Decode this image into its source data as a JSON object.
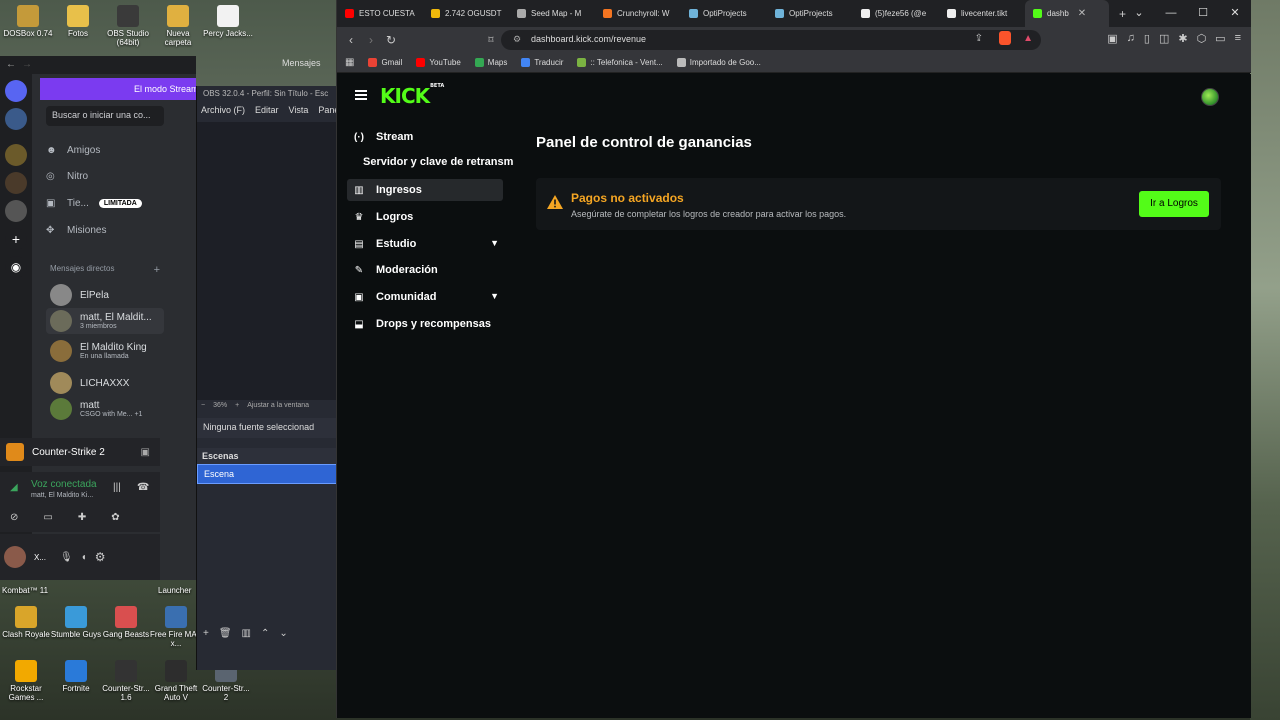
{
  "desktop": {
    "top_icons": [
      {
        "label": "DOSBox 0.74",
        "color": "#c49a3a"
      },
      {
        "label": "Fotos",
        "color": "#e8c04a"
      },
      {
        "label": "OBS Studio (64bit)",
        "color": "#3a3a3a"
      },
      {
        "label": "Nueva carpeta",
        "color": "#e0b040"
      },
      {
        "label": "Percy Jacks...",
        "color": "#f2f2f2"
      }
    ],
    "bottom_icons": [
      {
        "label": "Clash Royale",
        "color": "#d9a52a"
      },
      {
        "label": "Stumble Guys",
        "color": "#3a9ad9"
      },
      {
        "label": "Gang Beasts",
        "color": "#d94f4f"
      },
      {
        "label": "Free Fire MAX x...",
        "color": "#3a6fb0"
      },
      {
        "label": "Rockstar Games ...",
        "color": "#f2a900"
      },
      {
        "label": "Fortnite",
        "color": "#2a7ad9"
      },
      {
        "label": "Counter-Str... 1.6",
        "color": "#333333"
      },
      {
        "label": "Grand Theft Auto V",
        "color": "#2d2d2d"
      },
      {
        "label": "Counter-Str... 2",
        "color": "#5a6470"
      }
    ],
    "partial_labels": {
      "kombat": "Kombat™ 11",
      "launcher": "Launcher"
    }
  },
  "discord": {
    "window_title": "Mensajes",
    "banner": "El modo Stream",
    "search": "Buscar o iniciar una co...",
    "nav": [
      {
        "label": "Amigos",
        "icon": "friends-icon",
        "glyph": "☻"
      },
      {
        "label": "Nitro",
        "icon": "nitro-icon",
        "glyph": "◎"
      },
      {
        "label": "Tie...",
        "icon": "shop-icon",
        "glyph": "▣",
        "badge": "LIMITADA"
      },
      {
        "label": "Misiones",
        "icon": "quests-icon",
        "glyph": "✥"
      }
    ],
    "dm_header": "Mensajes directos",
    "dms": [
      {
        "name": "ElPela",
        "sub": "",
        "color": "#888"
      },
      {
        "name": "matt, El Maldit...",
        "sub": "3 miembros",
        "color": "#6b6b5a"
      },
      {
        "name": "El Maldito King",
        "sub": "En una llamada",
        "color": "#8a6d3b"
      },
      {
        "name": "LICHAXXX",
        "sub": "",
        "color": "#a08a5a"
      },
      {
        "name": "matt",
        "sub": "CSGO with Me...  +1",
        "color": "#5b7a3a"
      }
    ],
    "game": "Counter-Strike 2",
    "voice_title": "Voz conectada",
    "voice_sub": "matt, El Maldito Ki...",
    "user_short": "X..."
  },
  "obs": {
    "title": "OBS 32.0.4 - Perfil: Sin Título - Esc",
    "menu": [
      "Archivo (F)",
      "Editar",
      "Vista",
      "Pane"
    ],
    "zoom": "36%",
    "zoom_fit": "Ajustar a la ventana",
    "no_source": "Ninguna fuente seleccionad",
    "scenes_label": "Escenas",
    "scene": "Escena"
  },
  "browser": {
    "tabs": [
      {
        "label": "ESTO CUESTA",
        "color": "#ff0000"
      },
      {
        "label": "2.742 OGUSDT",
        "color": "#f0b90b"
      },
      {
        "label": "Seed Map - M",
        "color": "#aaaaaa"
      },
      {
        "label": "Crunchyroll: W",
        "color": "#f47521"
      },
      {
        "label": "OptiProjects",
        "color": "#6fb3d9"
      },
      {
        "label": "OptiProjects",
        "color": "#6fb3d9"
      },
      {
        "label": "(5)feze56 (@e",
        "color": "#eeeeee"
      },
      {
        "label": "livecenter.tikt",
        "color": "#eeeeee"
      },
      {
        "label": "dashb",
        "color": "#53fc18",
        "active": true
      }
    ],
    "url": "dashboard.kick.com/revenue",
    "bookmarks": [
      {
        "label": "Gmail",
        "color": "#ea4335"
      },
      {
        "label": "YouTube",
        "color": "#ff0000"
      },
      {
        "label": "Maps",
        "color": "#34a853"
      },
      {
        "label": "Traducir",
        "color": "#4285f4"
      },
      {
        "label": ":: Telefonica - Vent...",
        "color": "#7bb342"
      },
      {
        "label": "Importado de Goo...",
        "color": "#bbbbbb"
      }
    ]
  },
  "kick": {
    "logo": "KICK",
    "logo_tag": "BETA",
    "sidebar": [
      {
        "label": "Stream",
        "icon": "broadcast-icon",
        "glyph": "((·))"
      },
      {
        "label": "Servidor y clave de retransm",
        "sub": true
      },
      {
        "label": "Ingresos",
        "icon": "chart-icon",
        "glyph": "▥",
        "active": true
      },
      {
        "label": "Logros",
        "icon": "trophy-icon",
        "glyph": "🏆"
      },
      {
        "label": "Estudio",
        "icon": "studio-icon",
        "glyph": "▤",
        "expandable": true
      },
      {
        "label": "Moderación",
        "icon": "wrench-icon",
        "glyph": "🔧"
      },
      {
        "label": "Comunidad",
        "icon": "community-icon",
        "glyph": "▣",
        "expandable": true
      },
      {
        "label": "Drops y recompensas",
        "icon": "drops-icon",
        "glyph": "⬓"
      }
    ],
    "page_title": "Panel de control de ganancias",
    "alert": {
      "title": "Pagos no activados",
      "description": "Asegúrate de completar los logros de creador para activar los pagos.",
      "button": "Ir a Logros"
    },
    "accent": "#53fc18",
    "warning": "#f5a623"
  }
}
